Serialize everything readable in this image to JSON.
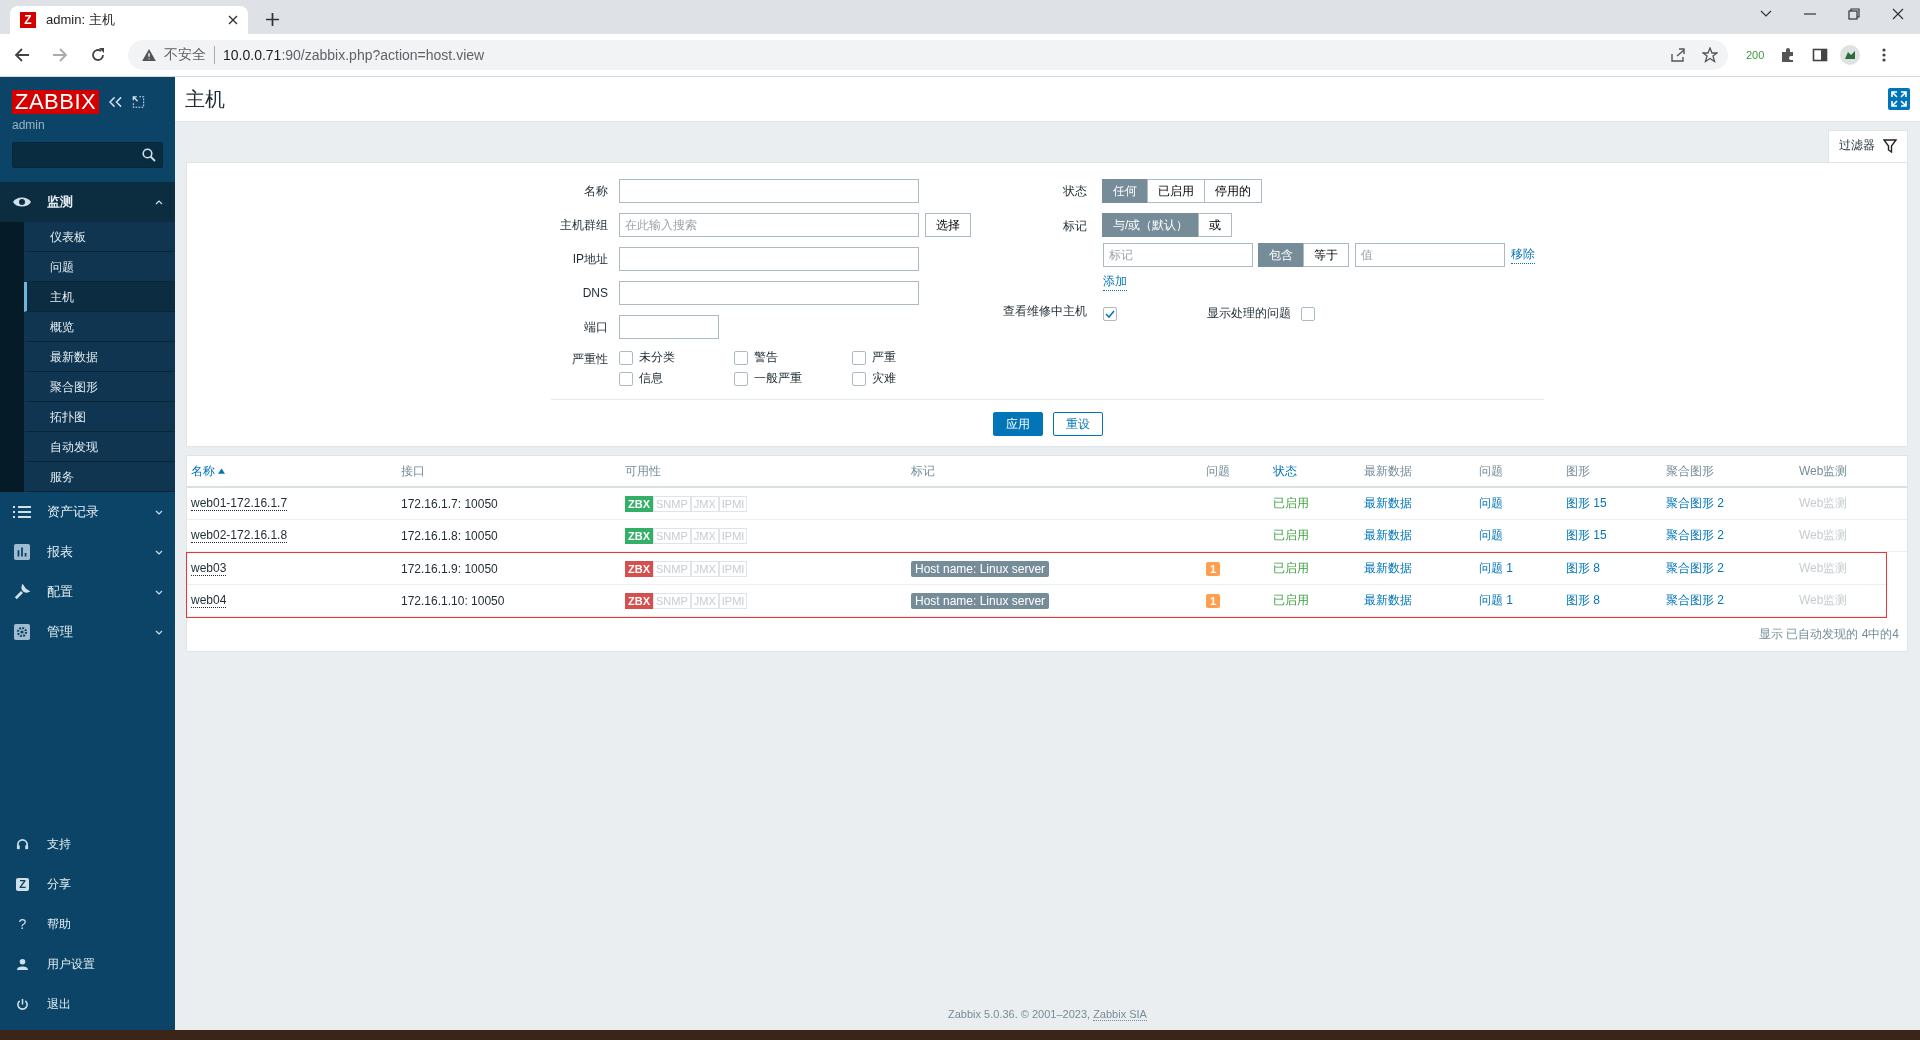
{
  "browser": {
    "tab_title": "admin: 主机",
    "favicon_letter": "Z",
    "security": "不安全",
    "url_host": "10.0.0.71",
    "url_rest": ":90/zabbix.php?action=host.view",
    "extension_badge": "200"
  },
  "sidebar": {
    "logo": "ZABBIX",
    "user": "admin",
    "sections": [
      {
        "label": "监测",
        "expanded": true,
        "children": [
          {
            "label": "仪表板",
            "selected": false
          },
          {
            "label": "问题",
            "selected": false
          },
          {
            "label": "主机",
            "selected": true
          },
          {
            "label": "概览",
            "selected": false
          },
          {
            "label": "最新数据",
            "selected": false
          },
          {
            "label": "聚合图形",
            "selected": false
          },
          {
            "label": "拓扑图",
            "selected": false
          },
          {
            "label": "自动发现",
            "selected": false
          },
          {
            "label": "服务",
            "selected": false
          }
        ]
      },
      {
        "label": "资产记录",
        "expanded": false
      },
      {
        "label": "报表",
        "expanded": false
      },
      {
        "label": "配置",
        "expanded": false
      },
      {
        "label": "管理",
        "expanded": false
      }
    ],
    "bottom": [
      {
        "label": "支持"
      },
      {
        "label": "分享",
        "glyph": "Z"
      },
      {
        "label": "帮助",
        "glyph": "?"
      },
      {
        "label": "用户设置"
      },
      {
        "label": "退出"
      }
    ]
  },
  "page": {
    "title": "主机",
    "filter_tab": "过滤器"
  },
  "filter": {
    "name_label": "名称",
    "group_label": "主机群组",
    "group_placeholder": "在此输入搜索",
    "select_button": "选择",
    "ip_label": "IP地址",
    "dns_label": "DNS",
    "port_label": "端口",
    "severity_label": "严重性",
    "severities": [
      {
        "label": "未分类",
        "checked": false
      },
      {
        "label": "警告",
        "checked": false
      },
      {
        "label": "严重",
        "checked": false
      },
      {
        "label": "信息",
        "checked": false
      },
      {
        "label": "一般严重",
        "checked": false
      },
      {
        "label": "灾难",
        "checked": false
      }
    ],
    "status_label": "状态",
    "status_options": [
      {
        "label": "任何",
        "selected": true
      },
      {
        "label": "已启用",
        "selected": false
      },
      {
        "label": "停用的",
        "selected": false
      }
    ],
    "tags_label": "标记",
    "tag_mode_options": [
      {
        "label": "与/或（默认）",
        "selected": true
      },
      {
        "label": "或",
        "selected": false
      }
    ],
    "tag_placeholder": "标记",
    "operator_options": [
      {
        "label": "包含",
        "selected": true
      },
      {
        "label": "等于",
        "selected": false
      }
    ],
    "value_placeholder": "值",
    "remove_link": "移除",
    "add_link": "添加",
    "maintenance_label": "查看维修中主机",
    "maintenance_checked": true,
    "suppressed_label": "显示处理的问题",
    "suppressed_checked": false,
    "apply_button": "应用",
    "reset_button": "重设"
  },
  "table": {
    "columns": [
      {
        "label": "名称",
        "sortable": true,
        "sorted": true
      },
      {
        "label": "接口",
        "sortable": false,
        "sorted": false
      },
      {
        "label": "可用性",
        "sortable": false,
        "sorted": false
      },
      {
        "label": "标记",
        "sortable": false,
        "sorted": false
      },
      {
        "label": "问题",
        "sortable": false,
        "sorted": false
      },
      {
        "label": "状态",
        "sortable": true,
        "sorted": false
      },
      {
        "label": "最新数据",
        "sortable": false,
        "sorted": false
      },
      {
        "label": "问题",
        "sortable": false,
        "sorted": false
      },
      {
        "label": "图形",
        "sortable": false,
        "sorted": false
      },
      {
        "label": "聚合图形",
        "sortable": false,
        "sorted": false
      },
      {
        "label": "Web监测",
        "sortable": false,
        "sorted": false
      }
    ],
    "rows": [
      {
        "name": "web01-172.16.1.7",
        "interface": "172.16.1.7: 10050",
        "availability": [
          {
            "label": "ZBX",
            "kind": "ok"
          },
          {
            "label": "SNMP",
            "kind": "unknown"
          },
          {
            "label": "JMX",
            "kind": "unknown"
          },
          {
            "label": "IPMI",
            "kind": "unknown"
          }
        ],
        "tags": [],
        "problem_count": "",
        "status": "已启用",
        "latest": "最新数据",
        "problems": "问题",
        "graphs": "图形 15",
        "screens": "聚合图形 2",
        "web": "Web监测",
        "web_disabled": true,
        "highlighted": false
      },
      {
        "name": "web02-172.16.1.8",
        "interface": "172.16.1.8: 10050",
        "availability": [
          {
            "label": "ZBX",
            "kind": "ok"
          },
          {
            "label": "SNMP",
            "kind": "unknown"
          },
          {
            "label": "JMX",
            "kind": "unknown"
          },
          {
            "label": "IPMI",
            "kind": "unknown"
          }
        ],
        "tags": [],
        "problem_count": "",
        "status": "已启用",
        "latest": "最新数据",
        "problems": "问题",
        "graphs": "图形 15",
        "screens": "聚合图形 2",
        "web": "Web监测",
        "web_disabled": true,
        "highlighted": false
      },
      {
        "name": "web03",
        "interface": "172.16.1.9: 10050",
        "availability": [
          {
            "label": "ZBX",
            "kind": "bad"
          },
          {
            "label": "SNMP",
            "kind": "unknown"
          },
          {
            "label": "JMX",
            "kind": "unknown"
          },
          {
            "label": "IPMI",
            "kind": "unknown"
          }
        ],
        "tags": [
          "Host name: Linux server"
        ],
        "problem_count": "1",
        "status": "已启用",
        "latest": "最新数据",
        "problems": "问题 1",
        "graphs": "图形 8",
        "screens": "聚合图形 2",
        "web": "Web监测",
        "web_disabled": true,
        "highlighted": true
      },
      {
        "name": "web04",
        "interface": "172.16.1.10: 10050",
        "availability": [
          {
            "label": "ZBX",
            "kind": "bad"
          },
          {
            "label": "SNMP",
            "kind": "unknown"
          },
          {
            "label": "JMX",
            "kind": "unknown"
          },
          {
            "label": "IPMI",
            "kind": "unknown"
          }
        ],
        "tags": [
          "Host name: Linux server"
        ],
        "problem_count": "1",
        "status": "已启用",
        "latest": "最新数据",
        "problems": "问题 1",
        "graphs": "图形 8",
        "screens": "聚合图形 2",
        "web": "Web监测",
        "web_disabled": true,
        "highlighted": true
      }
    ],
    "summary": "显示 已自动发现的 4中的4"
  },
  "footer": {
    "copyright": "Zabbix 5.0.36. © 2001–2023,",
    "company_link": "Zabbix SIA"
  }
}
